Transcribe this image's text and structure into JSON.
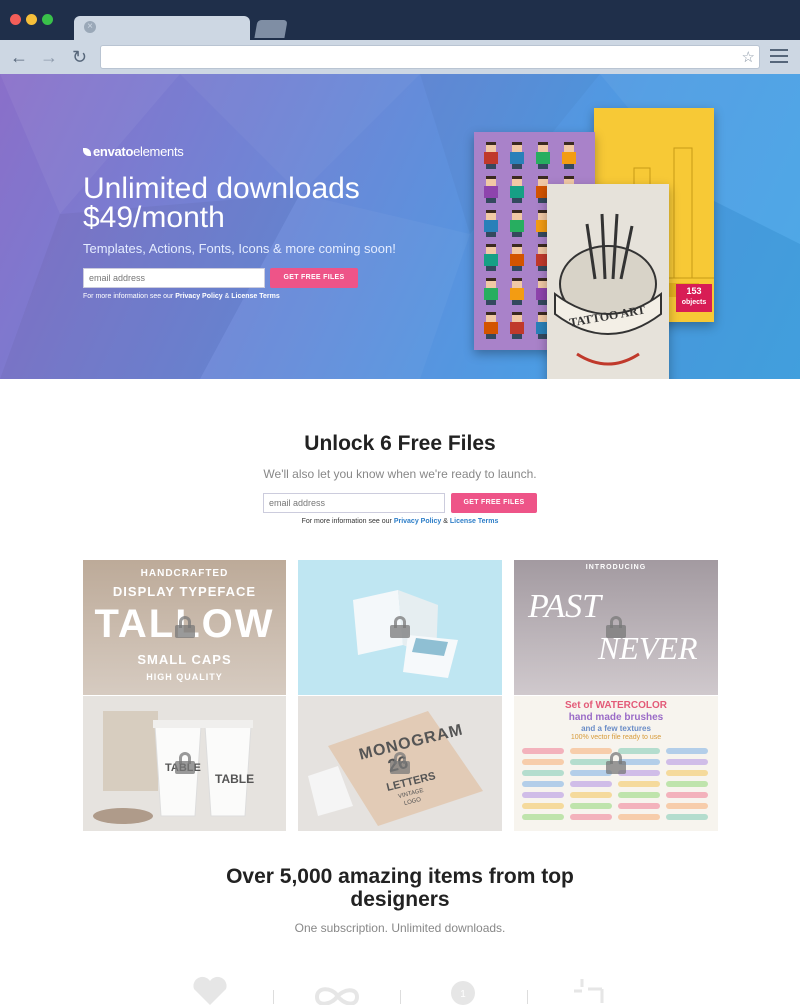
{
  "browser": {
    "tab_close": "×",
    "back": "←",
    "forward": "→",
    "reload": "↻",
    "star": "☆"
  },
  "hero": {
    "brand_bold": "envato",
    "brand_light": "elements",
    "title_line1": "Unlimited downloads",
    "title_line2": "$49/month",
    "subtitle": "Templates, Actions, Fonts, Icons & more coming soon!",
    "email_placeholder": "email address",
    "cta_label": "GET FREE FILES",
    "fine_prefix": "For more information see our ",
    "privacy": "Privacy Policy",
    "amp": " & ",
    "license": "License Terms",
    "badge_number": "153",
    "badge_label": "objects",
    "tattoo_text": "TATTOO ART"
  },
  "unlock": {
    "title": "Unlock 6 Free Files",
    "subtitle": "We'll also let you know when we're ready to launch.",
    "email_placeholder": "email address",
    "cta_label": "GET FREE FILES",
    "fine_prefix": "For more information see our ",
    "privacy": "Privacy Policy",
    "amp": " & ",
    "license": "License Terms"
  },
  "tiles": {
    "t1_line1": "HANDCRAFTED",
    "t1_line2": "DISPLAY TYPEFACE",
    "t1_line3": "TALLOW",
    "t1_line4": "SMALL CAPS",
    "t1_line5": "HIGH QUALITY",
    "t3_intro": "INTRODUCING",
    "t3_line1": "PAST",
    "t3_line2": "NEVER",
    "t4_label": "TABLE",
    "t5_line1": "MONOGRAM",
    "t5_line2": "26",
    "t5_line3": "LETTERS",
    "t5_line4": "VINTAGE",
    "t5_line5": "LOGO",
    "t6_line1": "Set of WATERCOLOR",
    "t6_line2": "hand made brushes",
    "t6_line3": "and a few textures",
    "t6_line4": "100% vector file ready to use"
  },
  "features": {
    "title_line1": "Over 5,000 amazing items from top",
    "title_line2": "designers",
    "subtitle": "One subscription. Unlimited downloads.",
    "badge_icon_text": "1"
  },
  "colors": {
    "accent": "#ee5488",
    "link": "#2d7ec8",
    "chrome": "#1f2f4a"
  }
}
